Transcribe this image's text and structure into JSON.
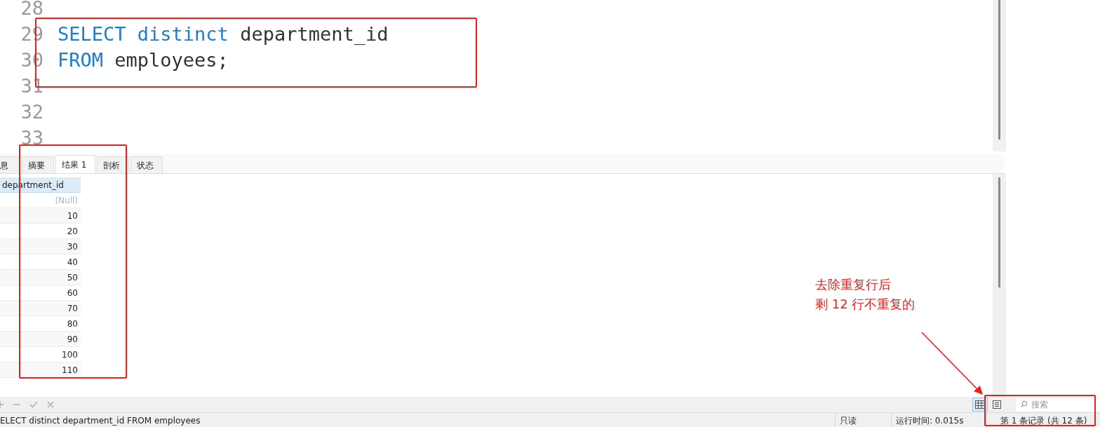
{
  "editor": {
    "lines": [
      {
        "number": "28"
      },
      {
        "number": "29",
        "tokens": [
          {
            "kind": "keyword",
            "text": "SELECT"
          },
          {
            "kind": "keyword",
            "text": "distinct"
          },
          {
            "kind": "ident",
            "text": "department_id"
          }
        ]
      },
      {
        "number": "30",
        "tokens": [
          {
            "kind": "keyword",
            "text": "FROM"
          },
          {
            "kind": "ident",
            "text": "employees;"
          }
        ]
      },
      {
        "number": "31"
      },
      {
        "number": "32"
      },
      {
        "number": "33"
      }
    ]
  },
  "tabs": [
    {
      "label": "息",
      "selected": false
    },
    {
      "label": "摘要",
      "selected": false
    },
    {
      "label": "结果 1",
      "selected": true
    },
    {
      "label": "剖析",
      "selected": false
    },
    {
      "label": "状态",
      "selected": false
    }
  ],
  "grid": {
    "columns": [
      "department_id"
    ],
    "rows": [
      {
        "value": "(Null)",
        "null": true
      },
      {
        "value": "10",
        "null": false
      },
      {
        "value": "20",
        "null": false
      },
      {
        "value": "30",
        "null": false
      },
      {
        "value": "40",
        "null": false
      },
      {
        "value": "50",
        "null": false
      },
      {
        "value": "60",
        "null": false
      },
      {
        "value": "70",
        "null": false
      },
      {
        "value": "80",
        "null": false
      },
      {
        "value": "90",
        "null": false
      },
      {
        "value": "100",
        "null": false
      },
      {
        "value": "110",
        "null": false
      }
    ]
  },
  "annotation": {
    "lines": [
      "去除重复行后",
      "剩 12 行不重复的"
    ]
  },
  "view_toggle": [
    {
      "kind": "grid",
      "selected": true
    },
    {
      "kind": "form",
      "selected": false
    }
  ],
  "search": {
    "placeholder": "搜索"
  },
  "status_bar": {
    "query": "ELECT distinct department_id FROM employees",
    "mode": "只读",
    "runtime": "运行时间: 0.015s",
    "record": "第 1 条记录 (共 12 条)"
  }
}
